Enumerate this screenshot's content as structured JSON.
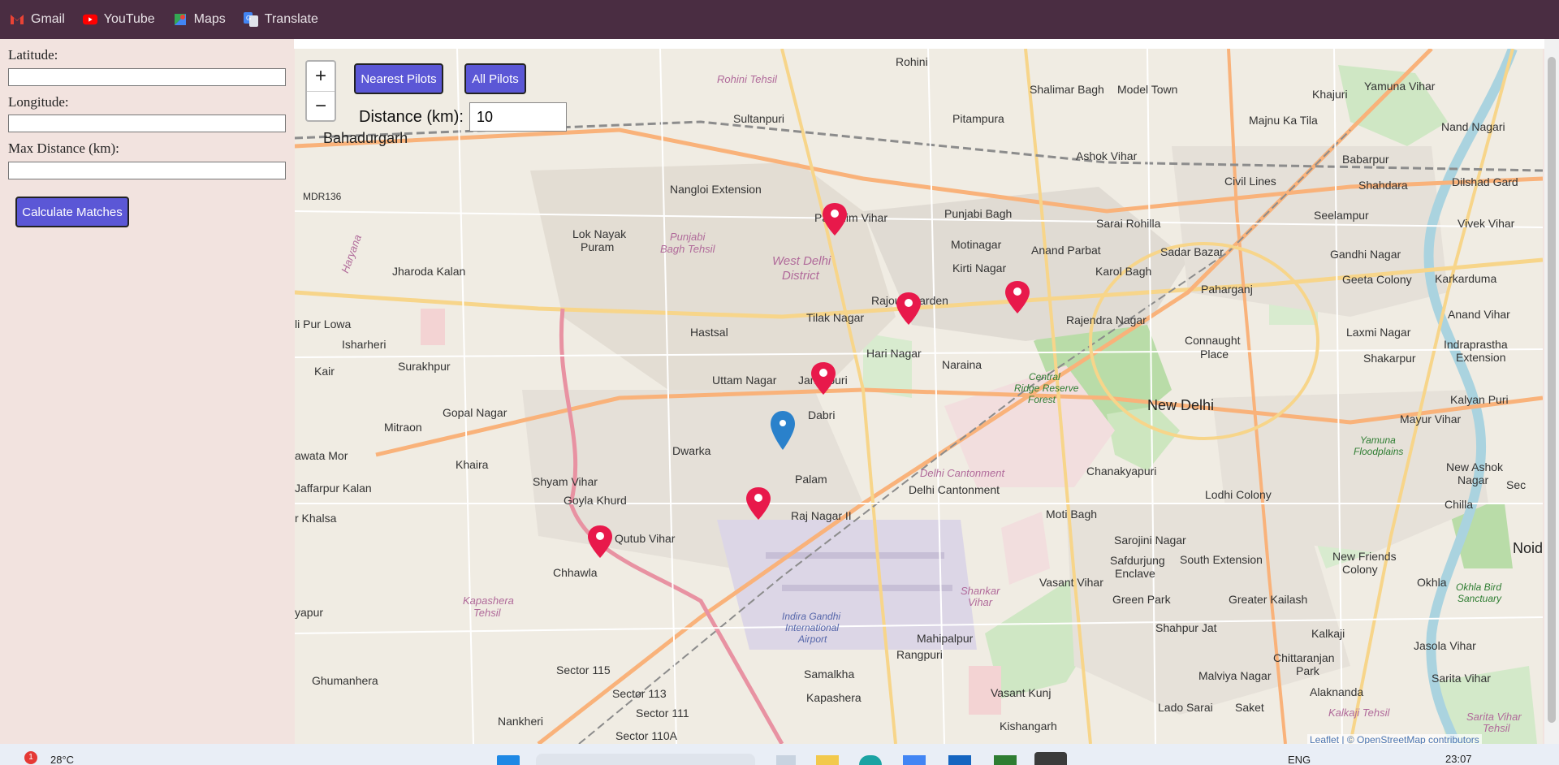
{
  "bookmarks": [
    {
      "label": "Gmail",
      "icon": "gmail-icon"
    },
    {
      "label": "YouTube",
      "icon": "youtube-icon"
    },
    {
      "label": "Maps",
      "icon": "maps-icon"
    },
    {
      "label": "Translate",
      "icon": "translate-icon"
    }
  ],
  "form": {
    "latitude_label": "Latitude:",
    "latitude_value": "",
    "longitude_label": "Longitude:",
    "longitude_value": "",
    "max_distance_label": "Max Distance (km):",
    "max_distance_value": "",
    "calculate_button": "Calculate Matches"
  },
  "map_controls": {
    "zoom_in": "+",
    "zoom_out": "−",
    "nearest_button": "Nearest Pilots",
    "all_button": "All Pilots",
    "distance_label": "Distance (km):",
    "distance_value": "10"
  },
  "places": {
    "rohini": "Rohini",
    "rohini_tehsil": "Rohini Tehsil",
    "sultanpuri": "Sultanpuri",
    "pitampura": "Pitampura",
    "shalimar_bagh": "Shalimar Bagh",
    "model_town": "Model Town",
    "majnu_ka_tila": "Majnu Ka Tila",
    "khajuri": "Khajuri",
    "yamuna_vihar": "Yamuna Vihar",
    "nand_nagari": "Nand Nagari",
    "bahadurgarh": "Bahadurgarh",
    "ashok_vihar": "Ashok Vihar",
    "civil_lines": "Civil Lines",
    "babarpur": "Babarpur",
    "shahdara": "Shahdara",
    "dilshad_garden": "Dilshad Gard",
    "mdr136": "MDR136",
    "nangloi_extension": "Nangloi Extension",
    "paschim_vihar": "Paschim Vihar",
    "punjabi_bagh": "Punjabi Bagh",
    "sarai_rohilla": "Sarai Rohilla",
    "seelampur": "Seelampur",
    "vivek_vihar": "Vivek Vihar",
    "lok_nayak_puram": "Lok Nayak",
    "puram": "Puram",
    "punjabi_bagh_tehsil": "Punjabi",
    "bagh_tehsil": "Bagh Tehsil",
    "west_delhi_district": "West Delhi",
    "district": "District",
    "motinagar": "Motinagar",
    "anand_parbat": "Anand Parbat",
    "sadar_bazar": "Sadar Bazar",
    "gandhi_nagar": "Gandhi Nagar",
    "haryana": "Haryana",
    "jharoda_kalan": "Jharoda Kalan",
    "kirti_nagar": "Kirti Nagar",
    "karol_bagh": "Karol Bagh",
    "geeta_colony": "Geeta Colony",
    "karkarduma": "Karkarduma",
    "rajouri_garden": "Rajouri Garden",
    "paharganj": "Paharganj",
    "li_pur_lowa": "li Pur Lowa",
    "hastsal": "Hastsal",
    "tilak_nagar": "Tilak Nagar",
    "rajendra_nagar": "Rajendra Nagar",
    "laxmi_nagar": "Laxmi Nagar",
    "anand_vihar": "Anand Vihar",
    "isharheri": "Isharheri",
    "connaught_place": "Connaught",
    "place": "Place",
    "hari_nagar": "Hari Nagar",
    "shakarpur": "Shakarpur",
    "indraprastha": "Indraprastha",
    "extension": "Extension",
    "kair": "Kair",
    "surakhpur": "Surakhpur",
    "uttam_nagar": "Uttam Nagar",
    "janakpuri": "Janakpuri",
    "naraina": "Naraina",
    "central_ridge": "Central",
    "ridge_reserve": "Ridge Reserve",
    "forest": "Forest",
    "new_delhi": "New Delhi",
    "kalyan_puri": "Kalyan Puri",
    "gopal_nagar": "Gopal Nagar",
    "dabri": "Dabri",
    "mayur_vihar": "Mayur Vihar",
    "mitraon": "Mitraon",
    "yamuna_floodplains": "Yamuna",
    "floodplains": "Floodplains",
    "dwarka": "Dwarka",
    "chanakyapuri": "Chanakyapuri",
    "delhi_cantonment_it": "Delhi Cantonment",
    "delhi_cantonment": "Delhi Cantonment",
    "new_ashok_nagar": "New Ashok",
    "nagar": "Nagar",
    "awata_mor": "awata Mor",
    "khaira": "Khaira",
    "palam": "Palam",
    "shyam_vihar": "Shyam Vihar",
    "lodhi_colony": "Lodhi Colony",
    "chilla": "Chilla",
    "jaffarpur_kalan": "Jaffarpur Kalan",
    "goyla_khurd": "Goyla Khurd",
    "moti_bagh": "Moti Bagh",
    "sec": "Sec",
    "khalsa": "r Khalsa",
    "raj_nagar": "Raj Nagar II",
    "qutub_vihar": "Qutub Vihar",
    "sarojini_nagar": "Sarojini Nagar",
    "noida": "Noid",
    "chhawla": "Chhawla",
    "safdurjung": "Safdurjung",
    "enclave": "Enclave",
    "south_extension": "South Extension",
    "new_friends": "New Friends",
    "colony": "Colony",
    "okhla": "Okhla",
    "okhla_bird": "Okhla Bird",
    "sanctuary": "Sanctuary",
    "shankar_vihar": "Shankar",
    "vihar": "Vihar",
    "vasant_vihar": "Vasant Vihar",
    "green_park": "Green Park",
    "greater_kailash": "Greater Kailash",
    "kapashera_tehsil": "Kapashera",
    "tehsil": "Tehsil",
    "yapur": "yapur",
    "igi_airport_1": "Indira Gandhi",
    "igi_airport_2": "International",
    "igi_airport_3": "Airport",
    "shahpur_jat": "Shahpur Jat",
    "kalkaji": "Kalkaji",
    "jasola_vihar": "Jasola Vihar",
    "mahipalpur": "Mahipalpur",
    "rangpuri": "Rangpuri",
    "chittaranjan_park": "Chittaranjan",
    "park": "Park",
    "sarita_vihar": "Sarita Vihar",
    "sector_115": "Sector 115",
    "samalkha": "Samalkha",
    "malviya_nagar": "Malviya Nagar",
    "ghumanhera": "Ghumanhera",
    "sector_113": "Sector 113",
    "kapashera": "Kapashera",
    "vasant_kunj": "Vasant Kunj",
    "alaknanda": "Alaknanda",
    "sector_111": "Sector 111",
    "nankheri": "Nankheri",
    "lado_sarai": "Lado Sarai",
    "saket": "Saket",
    "kalkaji_tehsil": "Kalkaji Tehsil",
    "sarita_vihar_tehsil": "Sarita Vihar",
    "tehsil2": "Tehsil",
    "kishangarh": "Kishangarh",
    "sector_110a": "Sector 110A"
  },
  "markers": {
    "pilot_marker_color": "#e8194b",
    "selected_marker_color": "#2a81cb"
  },
  "attribution": "Leaflet | © OpenStreetMap contributors",
  "taskbar": {
    "weather_temp": "28°C",
    "notification_count": "1",
    "language": "ENG",
    "time": "23:07"
  },
  "colors": {
    "bookmark_bar": "#4a2d42",
    "sidebar": "#f2e3df",
    "button": "#5b57d6"
  }
}
